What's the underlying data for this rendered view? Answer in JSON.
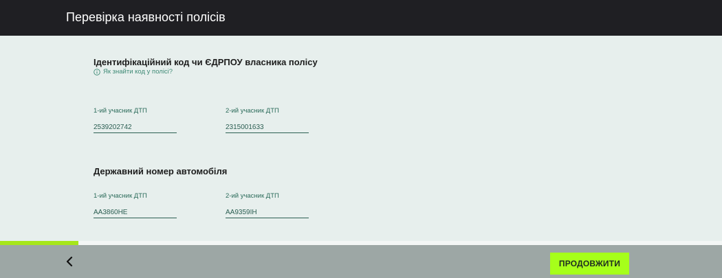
{
  "header": {
    "title": "Перевірка наявності полісів"
  },
  "id_section": {
    "title": "Ідентифікаційний код чи ЄДРПОУ власника полісу",
    "hint": "Як знайти код у полісі?",
    "hint_icon": "info-icon",
    "fields": [
      {
        "label": "1-ий учасник ДТП",
        "value": "2539202742"
      },
      {
        "label": "2-ий учасник ДТП",
        "value": "2315001633"
      }
    ]
  },
  "plate_section": {
    "title": "Державний номер автомобіля",
    "fields": [
      {
        "label": "1-ий учасник ДТП",
        "value": "АА3860НЕ"
      },
      {
        "label": "2-ий учасник ДТП",
        "value": "АА9359ІН"
      }
    ]
  },
  "progress": {
    "fraction": 0.109
  },
  "footer": {
    "back_icon": "chevron-left-icon",
    "continue_label": "ПРОДОВЖИТИ"
  },
  "colors": {
    "accent": "#a6ff1a",
    "header_bg": "#1f1f23",
    "content_bg": "#e7efed",
    "footer_bg": "#9da7a5",
    "field_text": "#2b5e52"
  }
}
